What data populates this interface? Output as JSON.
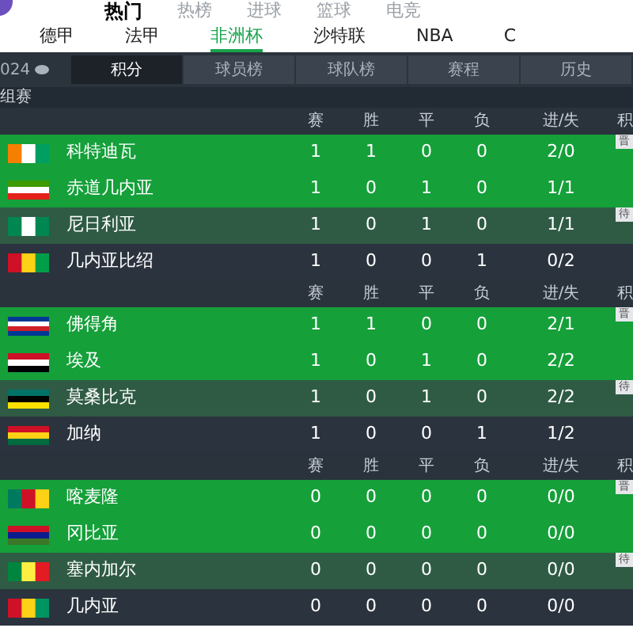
{
  "top_nav": [
    {
      "label": "热门",
      "selected": true
    },
    {
      "label": "热榜",
      "selected": false
    },
    {
      "label": "进球",
      "selected": false
    },
    {
      "label": "篮球",
      "selected": false
    },
    {
      "label": "电竞",
      "selected": false
    }
  ],
  "league_tabs": [
    {
      "label": "德甲",
      "selected": false
    },
    {
      "label": "法甲",
      "selected": false
    },
    {
      "label": "非洲杯",
      "selected": true
    },
    {
      "label": "沙特联",
      "selected": false
    },
    {
      "label": "NBA",
      "selected": false
    },
    {
      "label": "C",
      "selected": false
    }
  ],
  "season": "024",
  "view_tabs": [
    {
      "label": "积分",
      "selected": true
    },
    {
      "label": "球员榜",
      "selected": false
    },
    {
      "label": "球队榜",
      "selected": false
    },
    {
      "label": "赛程",
      "selected": false
    },
    {
      "label": "历史",
      "selected": false
    }
  ],
  "stage_title": "组赛",
  "groups": [
    {
      "columns": [
        "赛",
        "胜",
        "平",
        "负",
        "进/失",
        "积"
      ],
      "rows": [
        {
          "team": "科特迪瓦",
          "kind": "qualified",
          "badge": "晋",
          "played": "1",
          "won": "1",
          "drawn": "0",
          "lost": "0",
          "goals": "2/0"
        },
        {
          "team": "赤道几内亚",
          "kind": "qualified",
          "played": "1",
          "won": "0",
          "drawn": "1",
          "lost": "0",
          "goals": "1/1"
        },
        {
          "team": "尼日利亚",
          "kind": "pending",
          "badge": "待",
          "played": "1",
          "won": "0",
          "drawn": "1",
          "lost": "0",
          "goals": "1/1"
        },
        {
          "team": "几内亚比绍",
          "kind": "out",
          "played": "1",
          "won": "0",
          "drawn": "0",
          "lost": "1",
          "goals": "0/2"
        }
      ]
    },
    {
      "columns": [
        "赛",
        "胜",
        "平",
        "负",
        "进/失",
        "积"
      ],
      "rows": [
        {
          "team": "佛得角",
          "kind": "qualified",
          "badge": "晋",
          "played": "1",
          "won": "1",
          "drawn": "0",
          "lost": "0",
          "goals": "2/1"
        },
        {
          "team": "埃及",
          "kind": "qualified",
          "played": "1",
          "won": "0",
          "drawn": "1",
          "lost": "0",
          "goals": "2/2"
        },
        {
          "team": "莫桑比克",
          "kind": "pending",
          "badge": "待",
          "played": "1",
          "won": "0",
          "drawn": "1",
          "lost": "0",
          "goals": "2/2"
        },
        {
          "team": "加纳",
          "kind": "out",
          "played": "1",
          "won": "0",
          "drawn": "0",
          "lost": "1",
          "goals": "1/2"
        }
      ]
    },
    {
      "columns": [
        "赛",
        "胜",
        "平",
        "负",
        "进/失",
        "积"
      ],
      "rows": [
        {
          "team": "喀麦隆",
          "kind": "qualified",
          "badge": "晋",
          "played": "0",
          "won": "0",
          "drawn": "0",
          "lost": "0",
          "goals": "0/0"
        },
        {
          "team": "冈比亚",
          "kind": "qualified",
          "played": "0",
          "won": "0",
          "drawn": "0",
          "lost": "0",
          "goals": "0/0"
        },
        {
          "team": "塞内加尔",
          "kind": "pending",
          "badge": "待",
          "played": "0",
          "won": "0",
          "drawn": "0",
          "lost": "0",
          "goals": "0/0"
        },
        {
          "team": "几内亚",
          "kind": "out",
          "played": "0",
          "won": "0",
          "drawn": "0",
          "lost": "0",
          "goals": "0/0"
        }
      ]
    }
  ]
}
